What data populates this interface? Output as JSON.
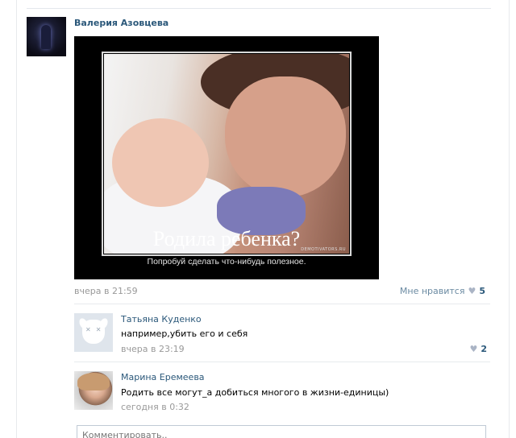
{
  "post": {
    "author": "Валерия Азовцева",
    "poster": {
      "headline": "Родила ребенка?",
      "subline": "Попробуй сделать что-нибудь  полезное.",
      "watermark": "DEMOTIVATORS.RU"
    },
    "time": "вчера в 21:59",
    "like_label": "Мне нравится",
    "like_count": "5",
    "like_icon": "heart-icon"
  },
  "comments": [
    {
      "name": "Татьяна Куденко",
      "text": "например,убить его и себя",
      "time": "вчера в 23:19",
      "like_count": "2",
      "avatar": "deactivated-dog-avatar"
    },
    {
      "name": "Марина Еремеева",
      "text": "Родить все могут_а добиться многого в жизни-единицы)",
      "time": "сегодня в 0:32",
      "avatar": "photo-avatar"
    }
  ],
  "comment_input": {
    "placeholder": "Комментировать.."
  },
  "colors": {
    "link": "#2b587a",
    "muted": "#999999",
    "heart": "#aab4c5",
    "divider": "#e7eaed"
  }
}
